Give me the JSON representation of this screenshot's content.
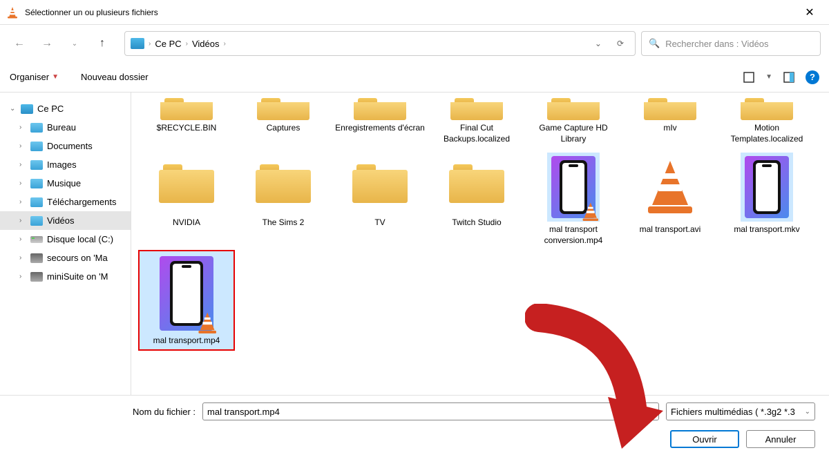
{
  "titlebar": {
    "title": "Sélectionner un ou plusieurs fichiers"
  },
  "breadcrumb": {
    "crumb1": "Ce PC",
    "crumb2": "Vidéos"
  },
  "search": {
    "placeholder": "Rechercher dans : Vidéos"
  },
  "toolbar": {
    "organize": "Organiser",
    "newfolder": "Nouveau dossier"
  },
  "sidebar": {
    "root": "Ce PC",
    "items": [
      {
        "label": "Bureau",
        "kind": "folder"
      },
      {
        "label": "Documents",
        "kind": "folder"
      },
      {
        "label": "Images",
        "kind": "folder"
      },
      {
        "label": "Musique",
        "kind": "folder"
      },
      {
        "label": "Téléchargements",
        "kind": "folder"
      },
      {
        "label": "Vidéos",
        "kind": "folder",
        "selected": true
      },
      {
        "label": "Disque local (C:)",
        "kind": "disk"
      },
      {
        "label": "secours on 'Ma",
        "kind": "net"
      },
      {
        "label": "miniSuite on 'M",
        "kind": "net"
      }
    ]
  },
  "files": {
    "row1": [
      {
        "name": "$RECYCLE.BIN",
        "kind": "folder"
      },
      {
        "name": "Captures",
        "kind": "folder"
      },
      {
        "name": "Enregistrements d'écran",
        "kind": "folder"
      },
      {
        "name": "Final Cut Backups.localized",
        "kind": "folder"
      },
      {
        "name": "Game Capture HD Library",
        "kind": "folder"
      },
      {
        "name": "mIv",
        "kind": "folder"
      },
      {
        "name": "Motion Templates.localized",
        "kind": "folder"
      }
    ],
    "row2": [
      {
        "name": "NVIDIA",
        "kind": "folder"
      },
      {
        "name": "The Sims 2",
        "kind": "folder"
      },
      {
        "name": "TV",
        "kind": "folder"
      },
      {
        "name": "Twitch Studio",
        "kind": "folder"
      },
      {
        "name": "mal transport conversion.mp4",
        "kind": "phone",
        "highlighted": true
      },
      {
        "name": "mal transport.avi",
        "kind": "cone"
      },
      {
        "name": "mal transport.mkv",
        "kind": "phone"
      }
    ],
    "row3": [
      {
        "name": "mal transport.mp4",
        "kind": "phone-cone",
        "selected": true
      }
    ]
  },
  "footer": {
    "filename_label": "Nom du fichier :",
    "filename_value": "mal transport.mp4",
    "filetype": "Fichiers multimédias ( *.3g2 *.3",
    "open": "Ouvrir",
    "cancel": "Annuler"
  }
}
